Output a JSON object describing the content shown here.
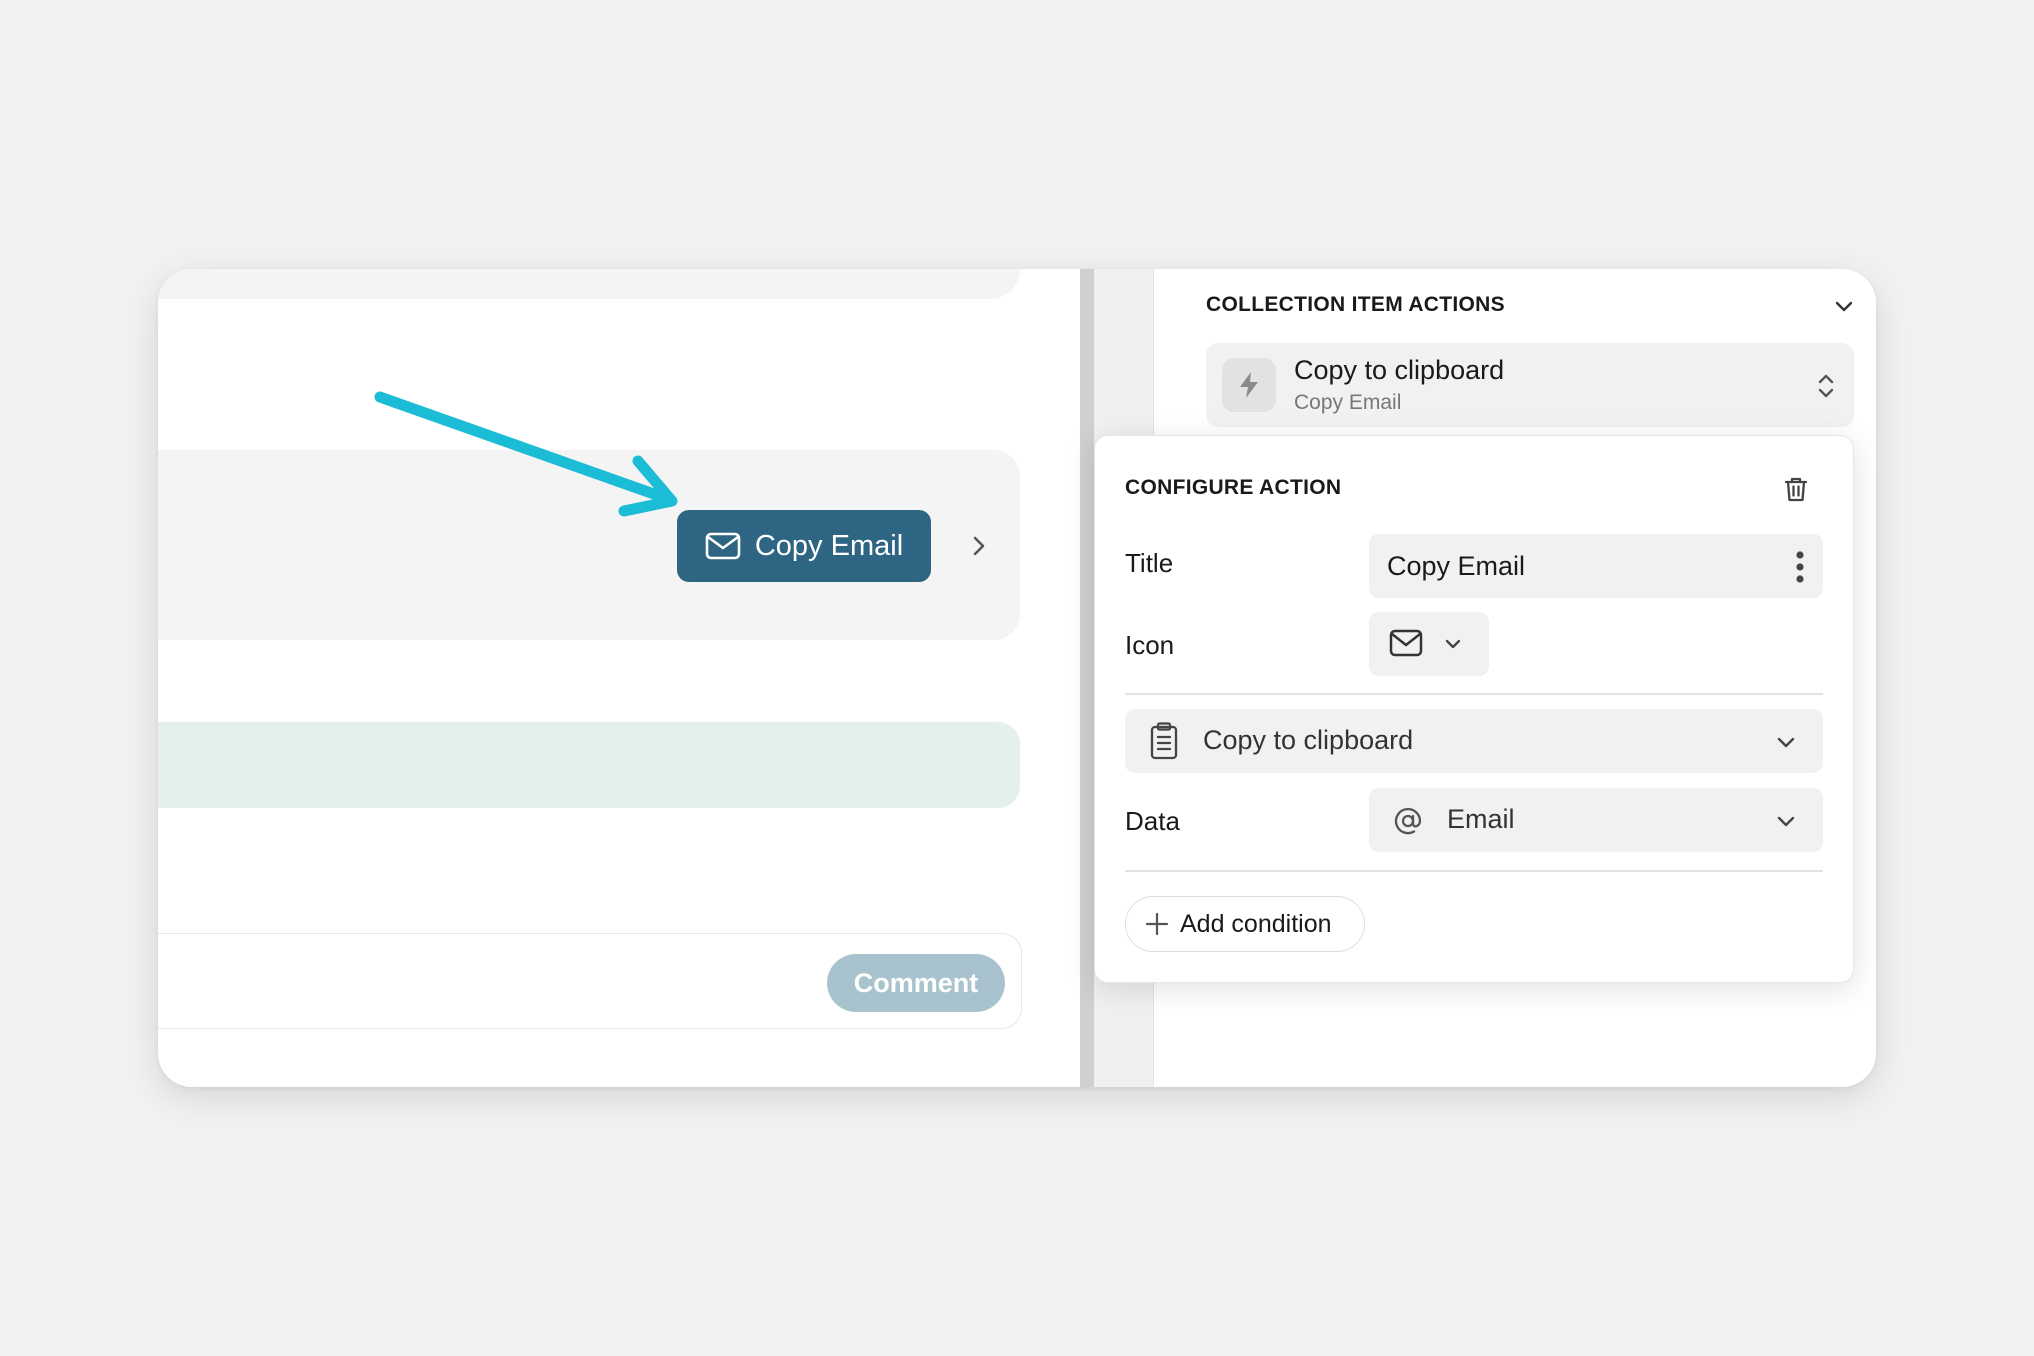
{
  "preview": {
    "action_button_label": "Copy Email",
    "comment_button_label": "Comment"
  },
  "panel": {
    "section_title": "COLLECTION ITEM ACTIONS",
    "action": {
      "title": "Copy to clipboard",
      "subtitle": "Copy Email"
    }
  },
  "configure": {
    "title": "CONFIGURE ACTION",
    "title_label": "Title",
    "title_value": "Copy Email",
    "icon_label": "Icon",
    "action_type": "Copy to clipboard",
    "data_label": "Data",
    "data_value": "Email",
    "add_condition_label": "Add condition"
  },
  "colors": {
    "accent": "#2e6583",
    "arrow": "#1bbcd6",
    "comment_disabled": "#a9c3ce",
    "success_bg": "#e4f1ea"
  },
  "icons": [
    "mail-icon",
    "chevron-right-icon",
    "chevron-down-icon",
    "lightning-icon",
    "up-down-icon",
    "trash-icon",
    "more-vertical-icon",
    "clipboard-icon",
    "at-icon",
    "plus-icon",
    "annotation-arrow"
  ]
}
